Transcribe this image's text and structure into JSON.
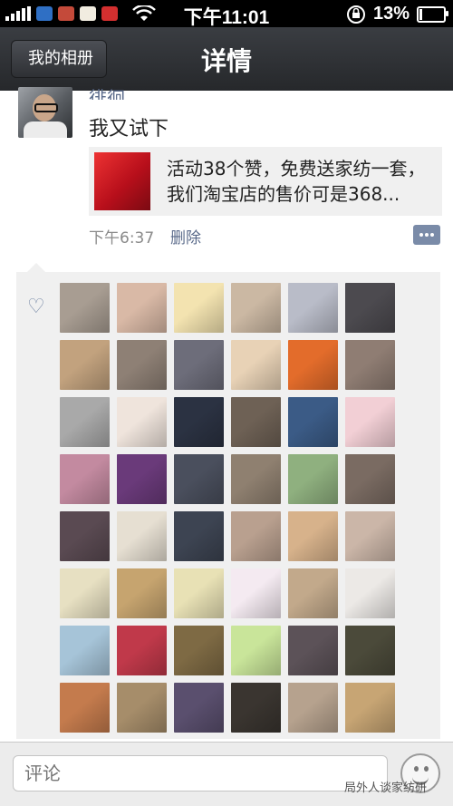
{
  "status_bar": {
    "time": "下午11:01",
    "battery_percent": "13%",
    "battery_level": 0.13,
    "icons": [
      "signal-icon",
      "cloud-app-icon",
      "grid-app-icon",
      "mahjong-app-icon",
      "flag-app-icon",
      "wifi-icon",
      "rotation-lock-icon",
      "battery-icon"
    ]
  },
  "nav": {
    "back_label": "我的相册",
    "title": "详情"
  },
  "post": {
    "author": "徘徊",
    "text": "我又试下",
    "share": {
      "line1": "活动38个赞，免费送家纺一套，",
      "line2": "我们淘宝店的售价可是368..."
    },
    "time": "下午6:37",
    "delete_label": "删除"
  },
  "likes": {
    "icon": "heart-icon",
    "avatars": [
      "#a89d92",
      "#d9b9a6",
      "#f3e3b0",
      "#cbb8a3",
      "#b9bcc8",
      "#4c4a4f",
      "#c2a27e",
      "#8e8075",
      "#6d6d7a",
      "#e8d2b6",
      "#e36c2b",
      "#8f7d73",
      "#a9a9a9",
      "#efe4dc",
      "#2b3242",
      "#6e6155",
      "#3b5b86",
      "#f2cfd5",
      "#c38aa0",
      "#6a3a7a",
      "#4a4f5d",
      "#8f8070",
      "#8fb07f",
      "#7a6b62",
      "#5a4a52",
      "#e6dfd2",
      "#3d4452",
      "#b9a08f",
      "#d7b28b",
      "#cbb6a8",
      "#e7e0c2",
      "#c6a46f",
      "#e8e1b5",
      "#f4eaf1",
      "#c2a98b",
      "#ece9e6",
      "#a6c4d8",
      "#c0394a",
      "#7e6a44",
      "#c9e59a",
      "#5c5258",
      "#4b4a3a",
      "#c47b4d",
      "#a68d6a",
      "#5a4f6e",
      "#3a3530",
      "#b6a28e",
      "#c7a574"
    ]
  },
  "bottom": {
    "comment_placeholder": "评论",
    "watermark": "局外人谈家纺研"
  }
}
